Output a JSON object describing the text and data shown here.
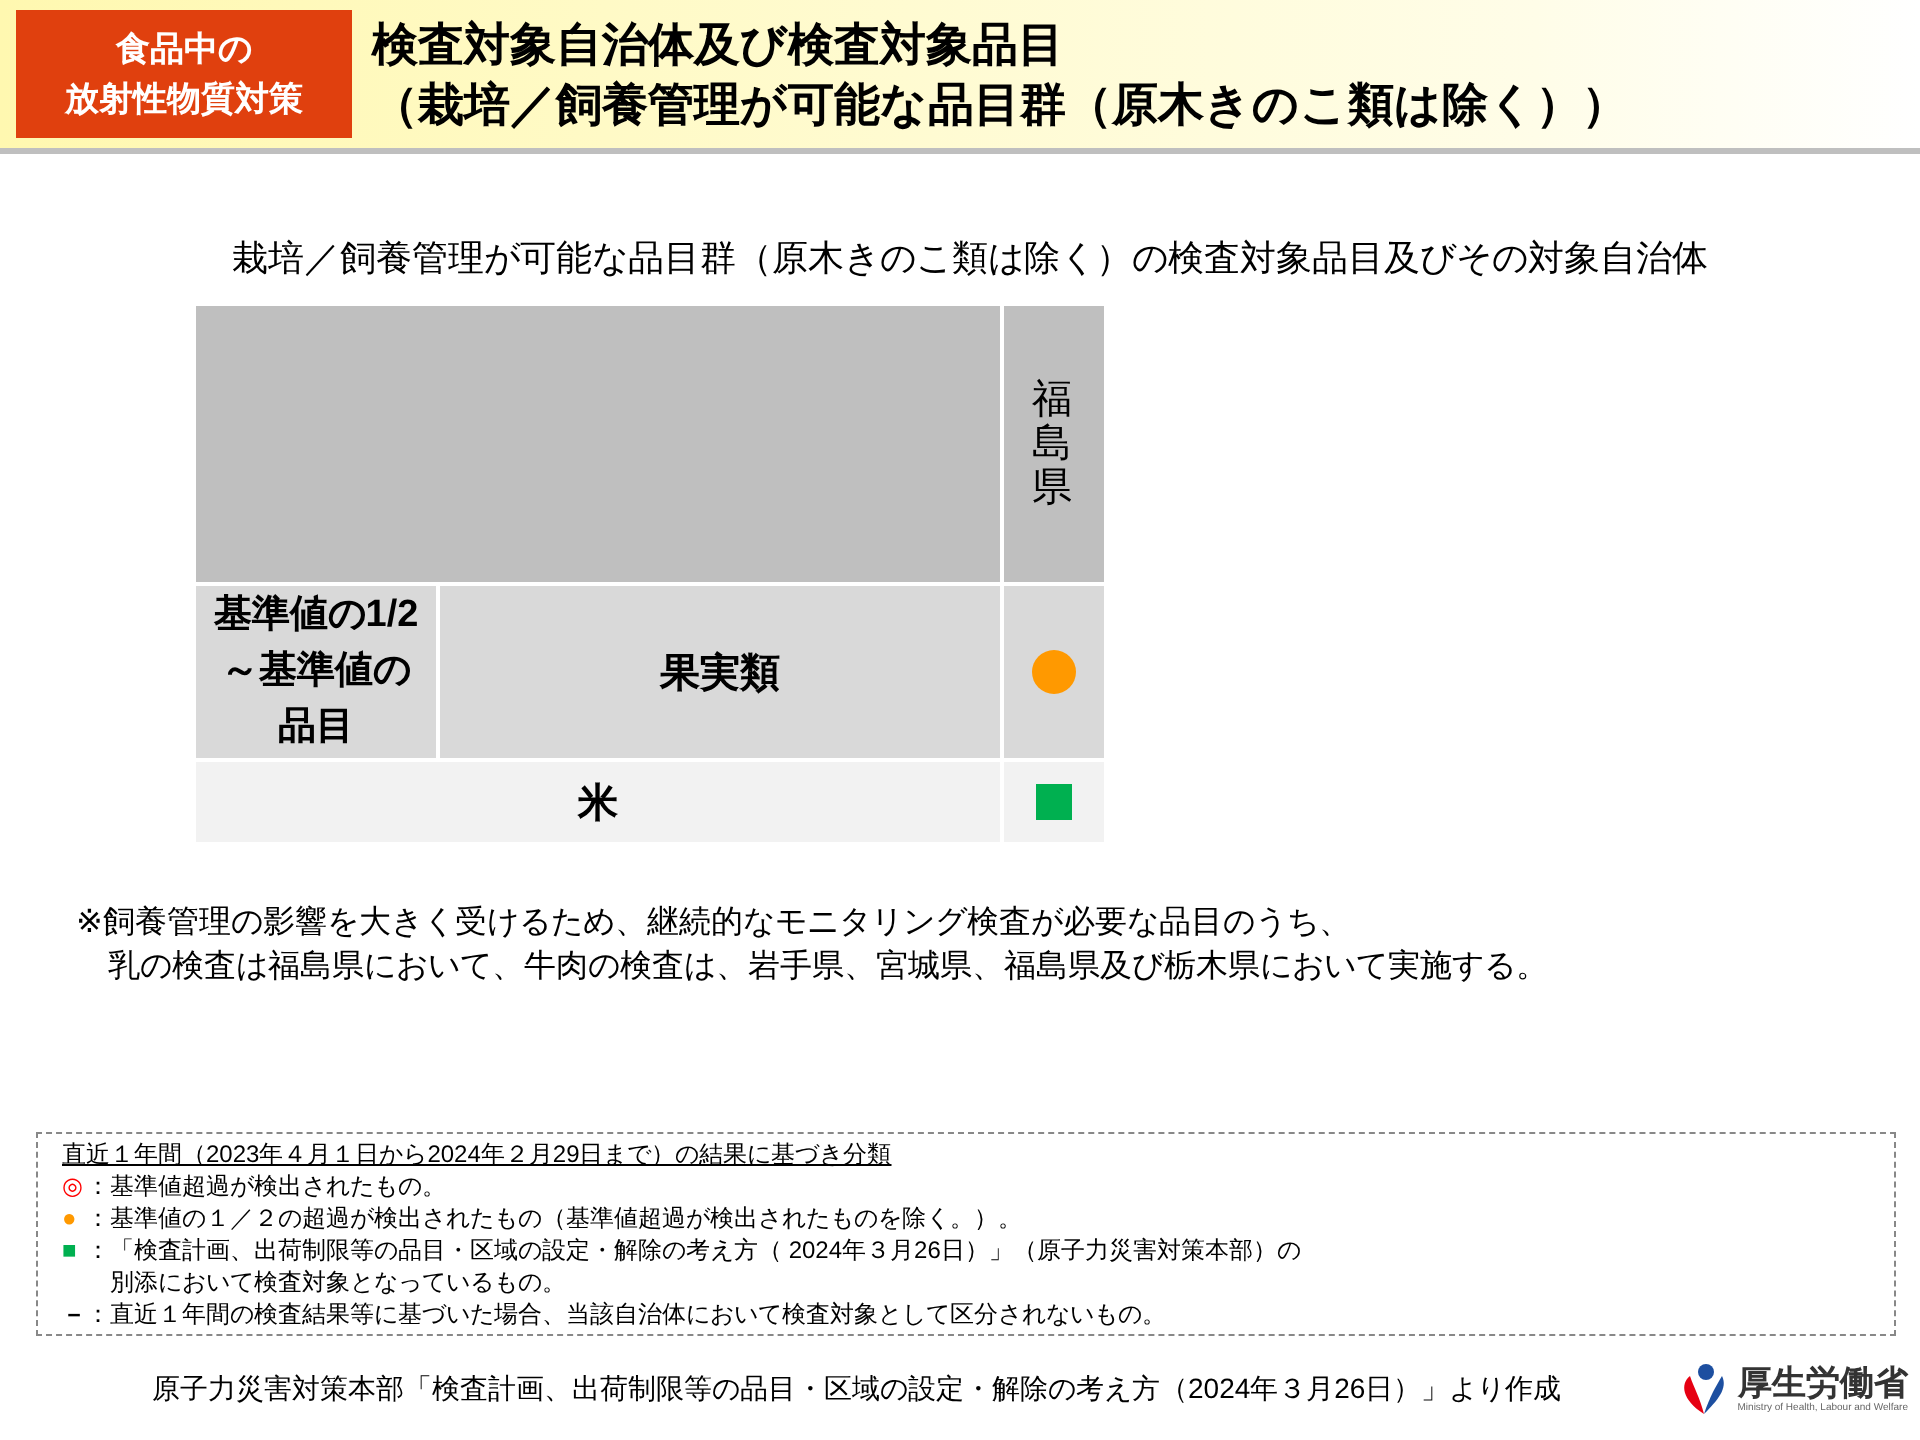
{
  "header": {
    "badge": [
      "食品中の",
      "放射性物質対策"
    ],
    "title": [
      "検査対象自治体及び検査対象品目",
      "（栽培／飼養管理が可能な品目群（原木きのこ類は除く））"
    ]
  },
  "subtitle": "栽培／飼養管理が可能な品目群（原木きのこ類は除く）の検査対象品目及びその対象自治体",
  "table": {
    "columns": [
      "福島県"
    ],
    "rows": [
      {
        "group": "基準値の1/2～基準値の品目",
        "item": "果実類",
        "marks": [
          {
            "kind": "circle",
            "color": "#ff9900"
          }
        ]
      },
      {
        "group": null,
        "item": "米",
        "marks": [
          {
            "kind": "square",
            "color": "#00b050"
          }
        ]
      }
    ]
  },
  "note": [
    "※飼養管理の影響を大きく受けるため、継続的なモニタリング検査が必要な品目のうち、",
    "乳の検査は福島県において、牛肉の検査は、岩手県、宮城県、福島県及び栃木県において実施する。"
  ],
  "legend": {
    "heading": "直近１年間（2023年４月１日から2024年２月29日まで）の結果に基づき分類",
    "items": [
      {
        "symbol": "◎",
        "color": "#ff0000",
        "text": "：基準値超過が検出されたもの。"
      },
      {
        "symbol": "●",
        "color": "#ff9900",
        "text": "：基準値の１／２の超過が検出されたもの（基準値超過が検出されたものを除く。）。"
      },
      {
        "symbol": "■",
        "color": "#00b050",
        "text": "：「検査計画、出荷制限等の品目・区域の設定・解除の考え方（ 2024年３月26日）」（原子力災害対策本部）の",
        "continuation": "別添において検査対象となっているもの。"
      },
      {
        "symbol": "－",
        "color": "#000000",
        "text": "：直近１年間の検査結果等に基づいた場合、当該自治体において検査対象として区分されないもの。"
      }
    ]
  },
  "source": "原子力災害対策本部「検査計画、出荷制限等の品目・区域の設定・解除の考え方（2024年３月26日）」より作成",
  "logo": {
    "name": "厚生労働省",
    "subtitle": "Ministry of Health, Labour and Welfare"
  }
}
